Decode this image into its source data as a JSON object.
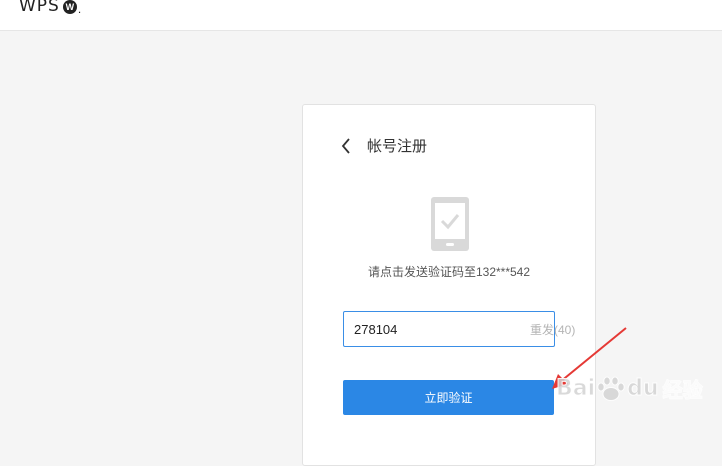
{
  "header": {
    "logo_text": "WPS",
    "logo_badge": "W",
    "logo_dot": "."
  },
  "card": {
    "back_icon": "chevron-left-icon",
    "title": "帐号注册",
    "phone_icon": "phone-check-icon",
    "hint": "请点击发送验证码至132***542",
    "code_input": {
      "value": "278104",
      "placeholder": ""
    },
    "resend_label": "重发(40)",
    "verify_label": "立即验证"
  },
  "watermark": {
    "brand_left": "Bai",
    "brand_right": "du",
    "suffix": "经验"
  },
  "colors": {
    "accent": "#2b87e5",
    "input_border": "#3a8ee6",
    "arrow": "#e53935",
    "page_bg": "#f5f5f5"
  }
}
